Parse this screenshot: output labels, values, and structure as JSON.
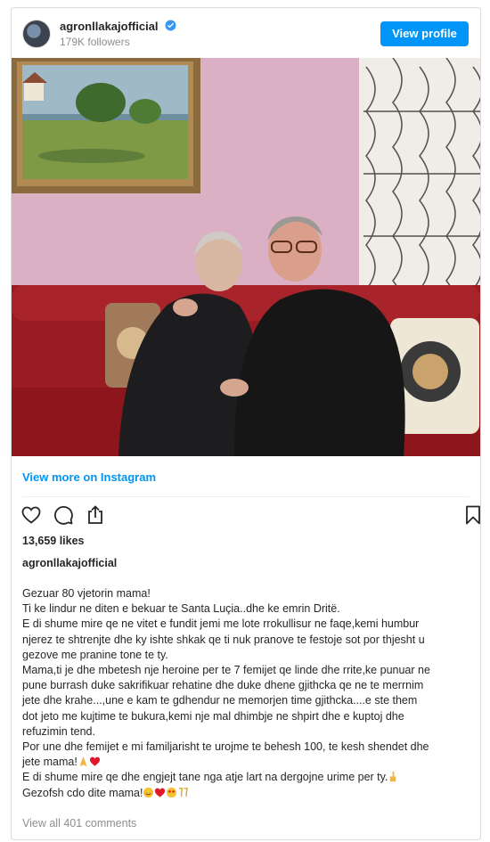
{
  "header": {
    "username": "agronllakajofficial",
    "followers": "179K followers",
    "view_profile": "View profile"
  },
  "post": {
    "photo_icon": "photo-mother-and-son",
    "view_more": "View more on Instagram",
    "likes": "13,659 likes",
    "author": "agronllakajofficial",
    "caption_lines": [
      "Gezuar 80 vjetorin mama!",
      "Ti ke lindur ne diten e bekuar te Santa Luçia..dhe ke emrin Dritë.",
      "E di shume mire qe ne vitet e fundit jemi me lote rrokullisur ne faqe,kemi humbur",
      "njerez te shtrenjte dhe ky ishte shkak qe ti nuk pranove te festoje sot por thjesht u",
      "gezove me pranine tone te ty.",
      "Mama,ti je dhe mbetesh nje heroine per te 7 femijet qe linde dhe rrite,ke punuar ne",
      "pune burrash duke sakrifikuar rehatine dhe duke dhene gjithcka qe ne te merrnim",
      "jete dhe krahe...,une e kam te gdhendur ne memorjen time gjithcka....e ste them",
      "dot jeto me kujtime te bukura,kemi nje mal dhimbje ne shpirt dhe e kuptoj dhe",
      "refuzimin tend.",
      "Por une dhe femijet e mi familjarisht te urojme te behesh 100, te kesh shendet dhe",
      "jete mama!",
      "E di shume mire qe dhe engjejt tane nga atje lart na dergojne urime per ty.",
      "Gezofsh cdo dite mama!"
    ],
    "view_comments": "View all 401 comments"
  },
  "icons": {
    "heart": "heart-outline-icon",
    "comment": "comment-icon",
    "share": "share-icon",
    "bookmark": "bookmark-icon"
  },
  "colors": {
    "accent": "#0095f6",
    "text": "#262626",
    "muted": "#8e8e8e"
  }
}
